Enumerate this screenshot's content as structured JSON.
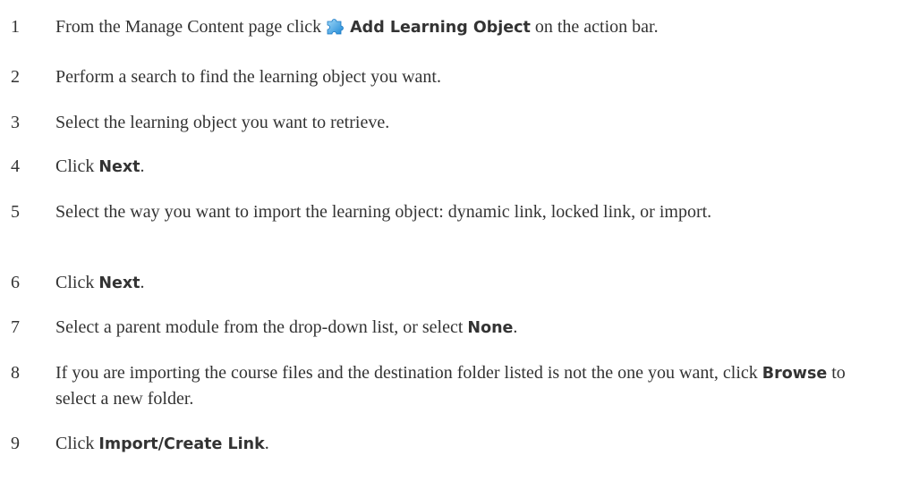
{
  "steps": [
    {
      "number": "1",
      "before": "From the Manage Content page click",
      "ui": "Add Learning Object",
      "after": "on the action bar.",
      "icon": "puzzle-piece-icon"
    },
    {
      "number": "2",
      "before": "Perform a search to find the learning object you want."
    },
    {
      "number": "3",
      "before": "Select the learning object you want to retrieve."
    },
    {
      "number": "4",
      "before": "Click",
      "ui": "Next",
      "after": "."
    },
    {
      "number": "5",
      "before": "Select the way you want to import the learning object: dynamic link, locked link, or import."
    },
    {
      "number": "6",
      "before": "Click",
      "ui": "Next",
      "after": "."
    },
    {
      "number": "7",
      "before": "Select a parent module from the drop-down list, or select",
      "ui": "None",
      "after": "."
    },
    {
      "number": "8",
      "before": "If you are importing the course files and the destination folder listed is not the one you want, click",
      "ui": "Browse",
      "after": "to select a new folder."
    },
    {
      "number": "9",
      "before": "Click",
      "ui": "Import/Create Link",
      "after": "."
    }
  ],
  "colors": {
    "text": "#333333",
    "icon_light": "#7ec8f4",
    "icon_dark": "#1e88d6"
  }
}
